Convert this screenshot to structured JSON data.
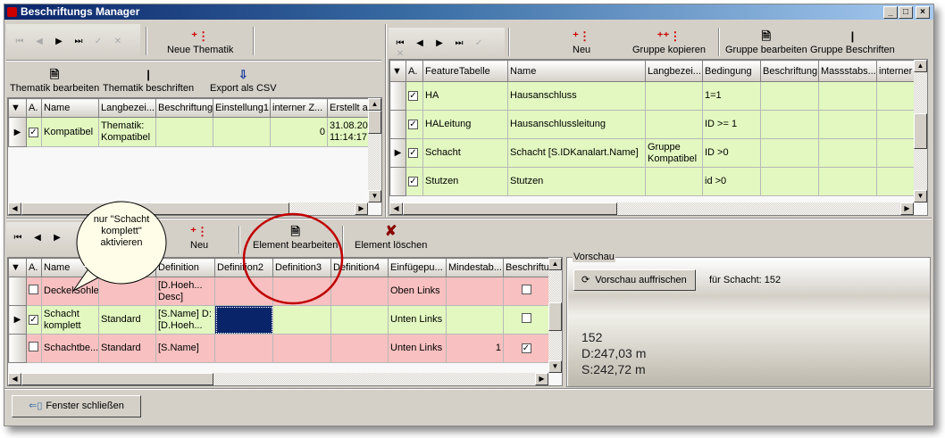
{
  "window": {
    "title": "Beschriftungs Manager",
    "controls": [
      "_",
      "□",
      "×"
    ]
  },
  "thematik": {
    "nav": [
      "⏮",
      "◀",
      "▶",
      "⏭",
      "✓",
      "✕"
    ],
    "new_label": "Neue Thematik",
    "actions": [
      "Thematik bearbeiten",
      "Thematik beschriften",
      "Export als CSV"
    ],
    "columns": [
      "A.",
      "Name",
      "Langbezei...",
      "Beschriftung",
      "Einstellung1",
      "interner Z...",
      "Erstellt a"
    ],
    "rows": [
      {
        "active": true,
        "name": "Kompatibel",
        "lang": "Thematik: Kompatibel",
        "beschriftung": "",
        "einstellung1": "",
        "intern": "0",
        "erstellt": "31.08.20 11:14:17"
      }
    ]
  },
  "gruppen": {
    "nav": [
      "⏮",
      "◀",
      "▶",
      "⏭",
      "✓",
      "✕"
    ],
    "actions": [
      "Neu",
      "Gruppe kopieren",
      "Gruppe bearbeiten",
      "Gruppe Beschriften"
    ],
    "columns": [
      "A.",
      "FeatureTabelle",
      "Name",
      "Langbezei...",
      "Bedingung",
      "Beschriftung",
      "Massstabs...",
      "interner"
    ],
    "rows": [
      {
        "active": true,
        "feature": "HA",
        "name": "Hausanschluss",
        "lang": "",
        "bedingung": "1=1"
      },
      {
        "active": true,
        "feature": "HALeitung",
        "name": "Hausanschlussleitung",
        "lang": "",
        "bedingung": "ID >= 1"
      },
      {
        "active": true,
        "feature": "Schacht",
        "name": "Schacht [S.IDKanalart.Name]",
        "lang": "Gruppe Kompatibel",
        "bedingung": "ID >0",
        "current": true
      },
      {
        "active": true,
        "feature": "Stutzen",
        "name": "Stutzen",
        "lang": "",
        "bedingung": "id >0"
      }
    ]
  },
  "elemente": {
    "nav": [
      "⏮",
      "◀",
      "▶"
    ],
    "actions": [
      "Neu",
      "Element bearbeiten",
      "Element löschen"
    ],
    "columns": [
      "A.",
      "Name",
      "",
      "Definition",
      "Definition2",
      "Definition3",
      "Definition4",
      "Einfügepu...",
      "Mindestab...",
      "Beschriftu"
    ],
    "rows": [
      {
        "active": false,
        "name": "DeckelSohle",
        "lang": "",
        "def": "[D.Hoeh... Desc]",
        "einfuege": "Oben Links",
        "mindest": "",
        "beschriftung": false,
        "status": "pink"
      },
      {
        "active": true,
        "name": "Schacht komplett",
        "lang": "Standard",
        "def": "[S.Name] D:[D.Hoeh...",
        "einfuege": "Unten Links",
        "mindest": "",
        "beschriftung": false,
        "status": "green",
        "current": true
      },
      {
        "active": false,
        "name": "Schachtbe...",
        "lang": "Standard",
        "def": "[S.Name]",
        "einfuege": "Unten Links",
        "mindest": "1",
        "beschriftung": true,
        "status": "pink"
      }
    ]
  },
  "callout": {
    "text": "nur \"Schacht komplett\" aktivieren"
  },
  "preview": {
    "group_label": "Vorschau",
    "refresh_label": "Vorschau auffrischen",
    "for_label": "für Schacht: 152",
    "lines": [
      "152",
      "D:247,03 m",
      "S:242,72 m"
    ]
  },
  "footer": {
    "close_label": "Fenster schließen"
  },
  "colors": {
    "active_row": "#e2f8c0",
    "inactive_row": "#f8c0c0",
    "selection": "#0a246a",
    "annotation": "#c00000"
  }
}
